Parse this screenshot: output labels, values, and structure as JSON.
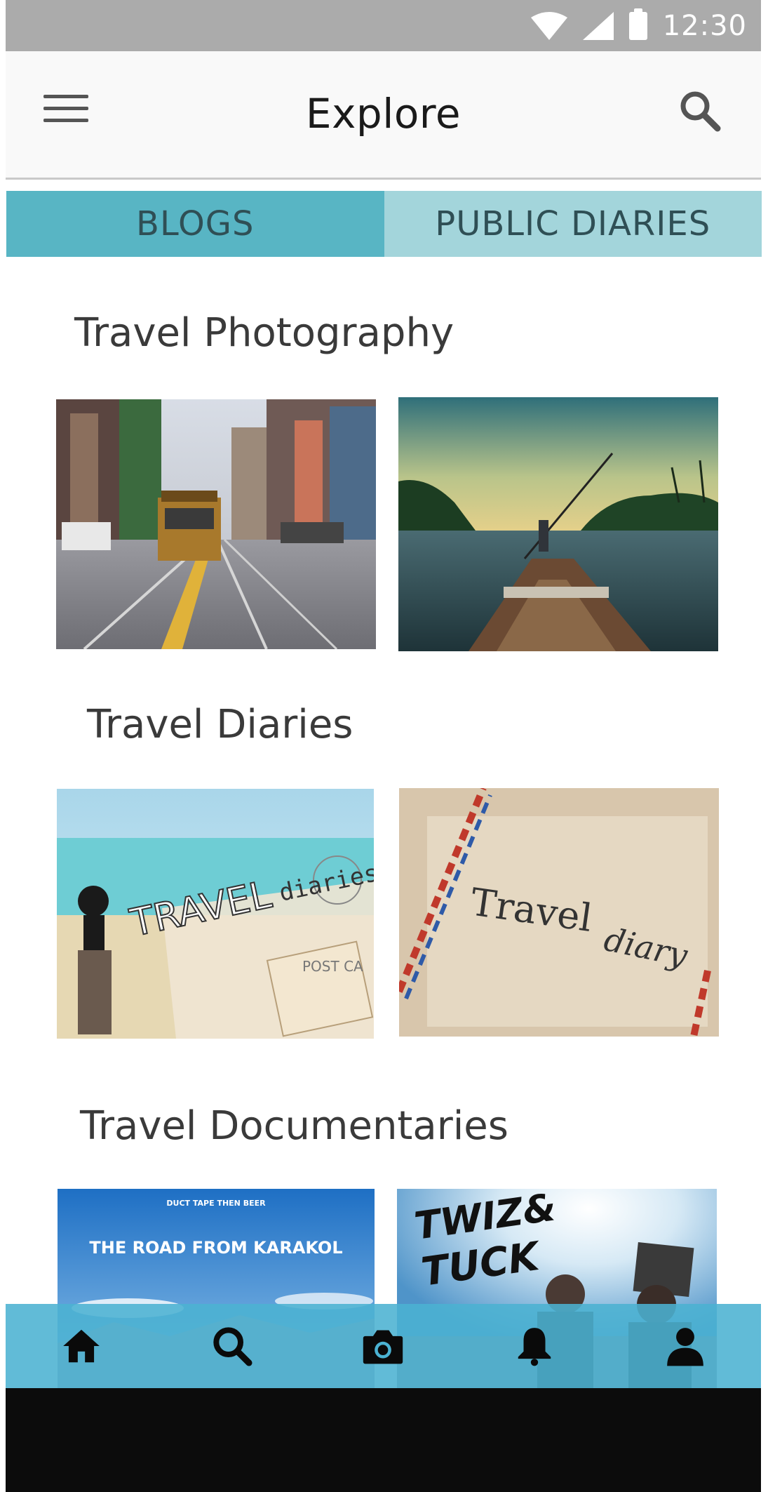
{
  "status_bar": {
    "time": "12:30"
  },
  "app_bar": {
    "title": "Explore"
  },
  "tabs": [
    {
      "label": "BLOGS",
      "active": true
    },
    {
      "label": "PUBLIC DIARIES",
      "active": false
    }
  ],
  "sections": [
    {
      "title": "Travel Photography",
      "items": [
        {
          "description": "cable-car-street-photo"
        },
        {
          "description": "boat-on-river-photo"
        }
      ]
    },
    {
      "title": "Travel Diaries",
      "items": [
        {
          "caption_word1": "TRAVEL",
          "caption_word2": "diaries",
          "stamp": "POST CA"
        },
        {
          "caption_word1": "Travel",
          "caption_word2": "diary"
        }
      ]
    },
    {
      "title": "Travel Documentaries",
      "items": [
        {
          "header_small": "DUCT TAPE THEN BEER",
          "headline": "THE ROAD FROM KARAKOL"
        },
        {
          "logo_line1": "TWIZ&",
          "logo_line2": "TUCK"
        }
      ]
    }
  ],
  "bottom_nav": [
    {
      "icon": "home-icon"
    },
    {
      "icon": "search-icon"
    },
    {
      "icon": "camera-icon"
    },
    {
      "icon": "bell-icon"
    },
    {
      "icon": "profile-icon"
    }
  ],
  "colors": {
    "status_bar": "#ababab",
    "tab_active": "#58b5c4",
    "tab_inactive": "#a3d5db",
    "bottom_nav": "#4bb2d2"
  }
}
